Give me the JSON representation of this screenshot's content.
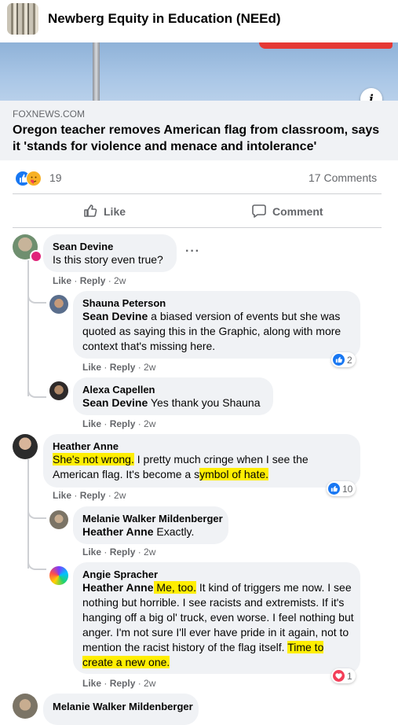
{
  "group": {
    "name": "Newberg Equity in Education (NEEd)"
  },
  "link": {
    "domain": "FOXNEWS.COM",
    "headline": "Oregon teacher removes American flag from classroom, says it 'stands for violence and menace and intolerance'"
  },
  "reactions": {
    "count": "19",
    "icons": [
      "like-icon",
      "care-icon"
    ]
  },
  "comments_count": "17 Comments",
  "actions": {
    "like": "Like",
    "comment": "Comment"
  },
  "comments": [
    {
      "name": "Sean Devine",
      "text": "Is this story even true?",
      "like": "Like",
      "reply": "Reply",
      "time": "2w",
      "more": "···"
    },
    {
      "name": "Shauna Peterson",
      "mention": "Sean Devine",
      "text": " a biased version of events but she was quoted as saying this in the Graphic, along with more context that's missing here.",
      "like": "Like",
      "reply": "Reply",
      "time": "2w",
      "reactions": "2",
      "reaction_icon": "like-icon"
    },
    {
      "name": "Alexa Capellen",
      "mention": "Sean Devine",
      "text": " Yes thank you Shauna",
      "like": "Like",
      "reply": "Reply",
      "time": "2w"
    },
    {
      "name": "Heather Anne",
      "hl1": "She's not wrong.",
      "t1": " I pretty much cringe when I see the American flag. It's become a s",
      "hl2": "ymbol of hate.",
      "like": "Like",
      "reply": "Reply",
      "time": "2w",
      "reactions": "10",
      "reaction_icon": "like-icon"
    },
    {
      "name": "Melanie Walker Mildenberger",
      "mention": "Heather Anne",
      "text": " Exactly.",
      "like": "Like",
      "reply": "Reply",
      "time": "2w"
    },
    {
      "name": "Angie Spracher",
      "mention": "Heather Anne",
      "hl1": " Me, too.",
      "t1": " It kind of triggers me now. I see nothing but horrible. I see racists and extremists. If it's hanging off a big ol' truck, even worse. I feel nothing but anger. I'm not sure I'll ever have pride in it again, not to mention the racist history of the flag itself. ",
      "hl2": "Time to create a new one.",
      "like": "Like",
      "reply": "Reply",
      "time": "2w",
      "reactions": "1",
      "reaction_icon": "heart-icon"
    },
    {
      "name": "Melanie Walker Mildenberger"
    }
  ],
  "colors": {
    "accent": "#1877f2",
    "highlight": "#ffee02",
    "heart": "#f33e58",
    "bubble": "#f0f2f5"
  }
}
